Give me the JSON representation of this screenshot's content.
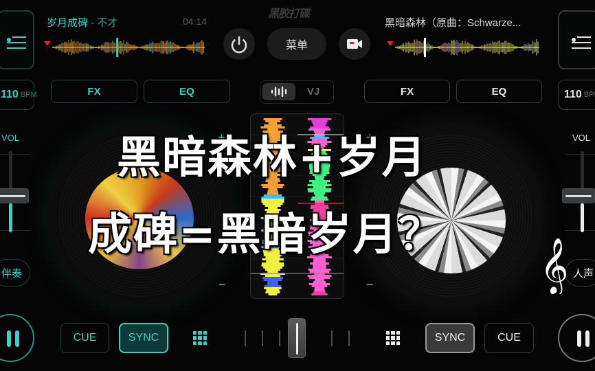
{
  "app": {
    "logo_text": "黑胶打碟"
  },
  "deck_left": {
    "track_title": "岁月成碑",
    "track_artist": " - 不才",
    "duration": "04:14",
    "bpm_value": "110",
    "bpm_unit": "BPM",
    "fx_label": "FX",
    "eq_label": "EQ",
    "vol_label": "VOL",
    "volume_level": 0.45,
    "stem_button_label": "伴奏",
    "cue_label": "CUE",
    "sync_label": "SYNC",
    "sync_active": true,
    "state": "playing",
    "accent_color": "#3ccfc3",
    "playhead_position": 0.42
  },
  "deck_right": {
    "track_title": "黑暗森林（原曲：Schwarze...",
    "bpm_value": "110",
    "bpm_unit": "BPM",
    "fx_label": "FX",
    "eq_label": "EQ",
    "vol_label": "VOL",
    "volume_level": 0.45,
    "stem_button_label": "人声",
    "cue_label": "CUE",
    "sync_label": "SYNC",
    "sync_active": true,
    "state": "playing",
    "accent_color": "#e6e6e6",
    "playhead_position": 0.2
  },
  "center": {
    "menu_label": "菜单",
    "view_toggle": {
      "waveform_icon": "waveform-icon",
      "vj_label": "VJ",
      "selected": "waveform"
    },
    "crossfader_position": 0.5
  },
  "icons": {
    "playlist": "playlist-icon",
    "power": "power-icon",
    "record": "video-record-icon",
    "pads": "pad-grid-icon",
    "pause": "pause-icon",
    "treble_clef": "treble-clef-icon"
  },
  "overlay_caption": {
    "line1": "黑暗森林+岁月",
    "line2": "成碑=黑暗岁月？"
  },
  "pitch_controls": {
    "plus": "+",
    "minus": "−"
  }
}
